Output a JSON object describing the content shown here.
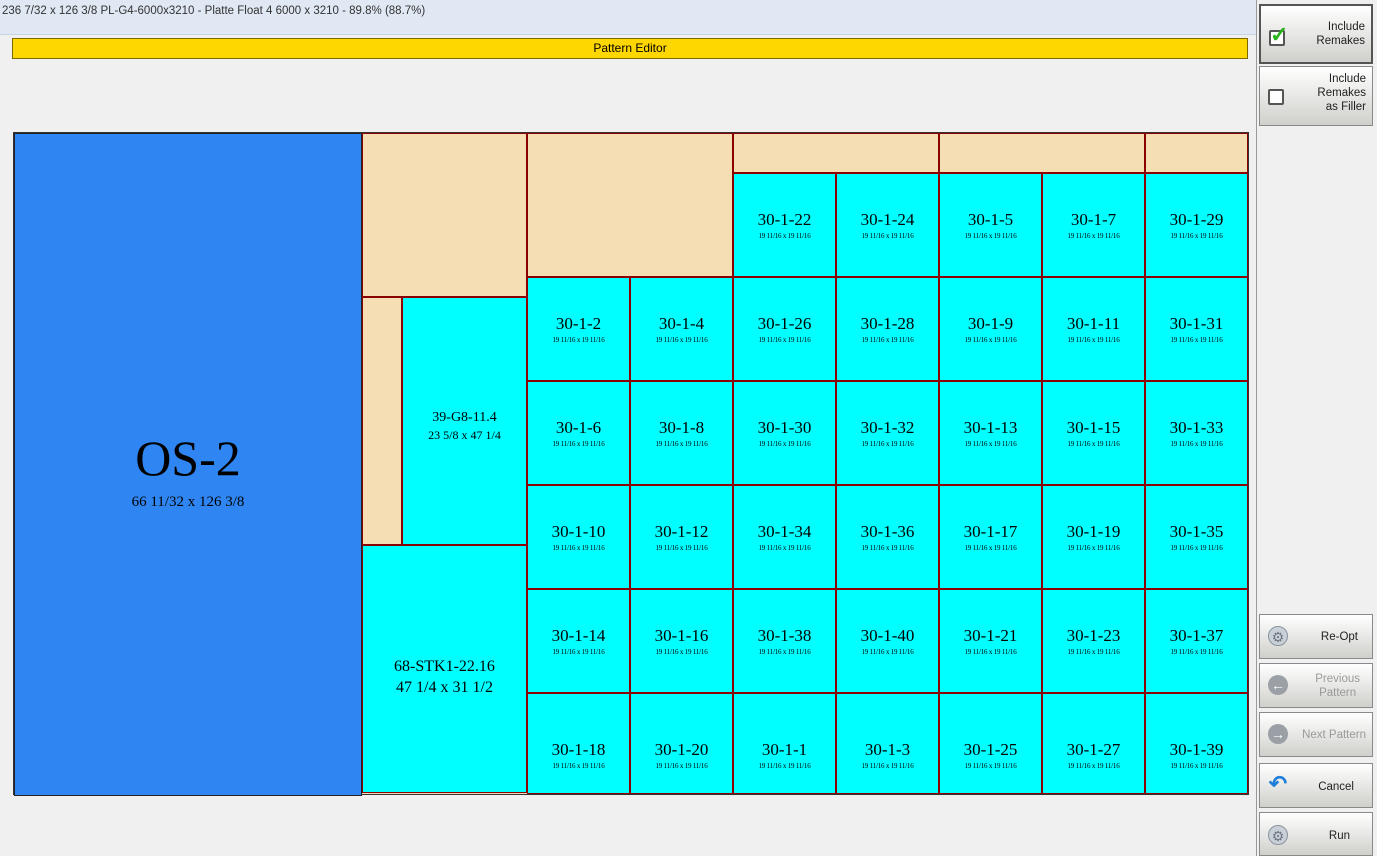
{
  "window": {
    "title": "236 7/32 x 126 3/8   PL-G4-6000x3210 - Platte Float 4 6000 x 3210  -  89.8% (88.7%)"
  },
  "editor": {
    "header": "Pattern Editor"
  },
  "colors": {
    "offcut": "#2f86f2",
    "part": "#00ffff",
    "waste": "#f5deb3",
    "header": "#ffd700",
    "border": "#8b0000"
  },
  "pieces": {
    "os": {
      "name": "OS-2",
      "dims": "66 11/32 x 126 3/8"
    },
    "p39": {
      "name": "39-G8-11.4",
      "dims": "23 5/8 x 47 1/4"
    },
    "p68": {
      "name": "68-STK1-22.16",
      "dims": "47 1/4 x 31 1/2"
    },
    "cell_dims": "19 11/16 x 19 11/16",
    "top_row": [
      "30-1-22",
      "30-1-24",
      "30-1-5",
      "30-1-7",
      "30-1-29"
    ],
    "rows": [
      [
        "30-1-2",
        "30-1-4",
        "30-1-26",
        "30-1-28",
        "30-1-9",
        "30-1-11",
        "30-1-31"
      ],
      [
        "30-1-6",
        "30-1-8",
        "30-1-30",
        "30-1-32",
        "30-1-13",
        "30-1-15",
        "30-1-33"
      ],
      [
        "30-1-10",
        "30-1-12",
        "30-1-34",
        "30-1-36",
        "30-1-17",
        "30-1-19",
        "30-1-35"
      ],
      [
        "30-1-14",
        "30-1-16",
        "30-1-38",
        "30-1-40",
        "30-1-21",
        "30-1-23",
        "30-1-37"
      ],
      [
        "30-1-18",
        "30-1-20",
        "30-1-1",
        "30-1-3",
        "30-1-25",
        "30-1-27",
        "30-1-39"
      ]
    ]
  },
  "sidebar": {
    "include_remakes": {
      "label_line1": "Include",
      "label_line2": "Remakes",
      "checked": true
    },
    "include_remakes_filler": {
      "label_line1": "Include",
      "label_line2": "Remakes",
      "label_line3": "as Filler",
      "checked": false
    },
    "reopt": {
      "label": "Re-Opt",
      "icon": "gear-icon"
    },
    "previous": {
      "label_line1": "Previous",
      "label_line2": "Pattern",
      "icon": "arrow-left-icon"
    },
    "next": {
      "label": "Next Pattern",
      "icon": "arrow-right-icon"
    },
    "cancel": {
      "label": "Cancel",
      "icon": "undo-icon"
    },
    "run": {
      "label": "Run",
      "icon": "gear-run-icon"
    }
  }
}
